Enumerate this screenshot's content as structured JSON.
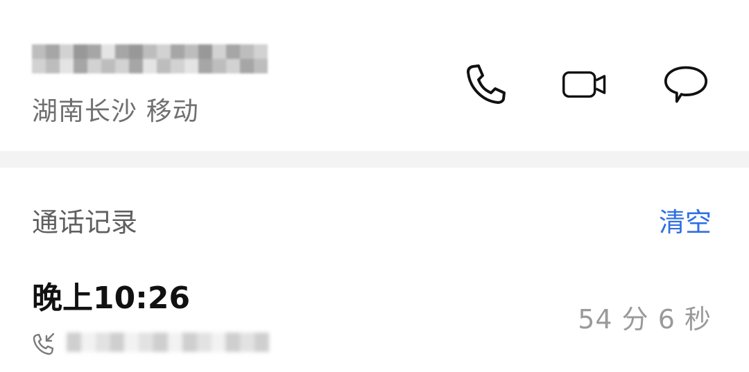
{
  "contact": {
    "location": "湖南长沙 移动",
    "actions": [
      {
        "name": "call",
        "icon": "phone-icon"
      },
      {
        "name": "video",
        "icon": "video-camera-icon"
      },
      {
        "name": "message",
        "icon": "chat-bubble-icon"
      }
    ]
  },
  "call_log": {
    "title": "通话记录",
    "clear_label": "清空",
    "entries": [
      {
        "time": "晚上10:26",
        "duration": "54 分 6 秒",
        "direction_icon": "incoming-call-icon"
      }
    ]
  },
  "colors": {
    "accent": "#2f6fe4",
    "primary_text": "#111111",
    "secondary_text": "#6f6f6f",
    "muted_text": "#9a9a9a",
    "divider": "#f3f3f3"
  }
}
